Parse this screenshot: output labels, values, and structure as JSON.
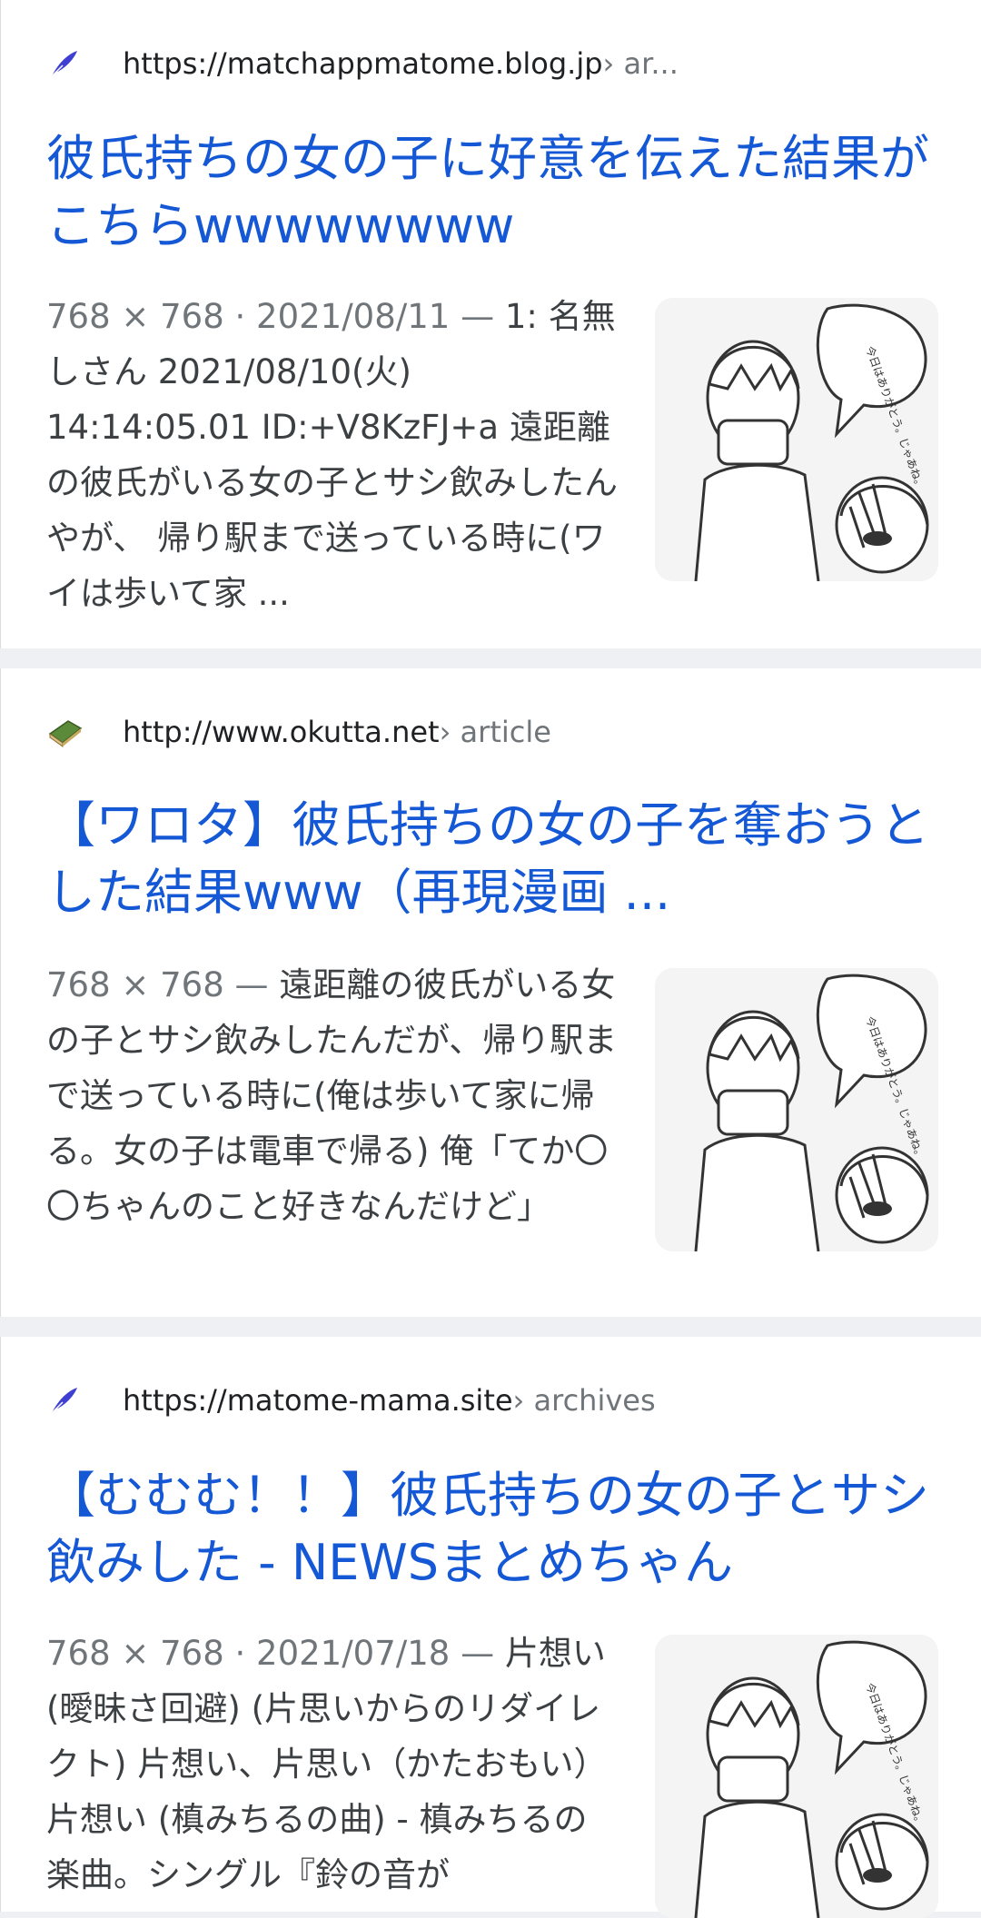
{
  "results": [
    {
      "favicon": "feather-icon",
      "url": "https://matchappmatome.blog.jp",
      "breadcrumb": " › ar...",
      "title": "彼氏持ちの女の子に好意を伝えた結果がこちらwwwwwwww",
      "meta": "768 × 768 · 2021/08/11 — ",
      "snippet": "1: 名無しさん 2021/08/10(火) 14:14:05.01 ID:+V8KzFJ+a 遠距離の彼氏がいる女の子とサシ飲みしたんやが、 帰り駅まで送っている時に(ワイは歩いて家 ...",
      "thumbnail": "manga-thumbnail"
    },
    {
      "favicon": "book-icon",
      "url": "http://www.okutta.net",
      "breadcrumb": " › article",
      "title": "【ワロタ】彼氏持ちの女の子を奪おうとした結果www（再現漫画 ...",
      "meta": "768 × 768 — ",
      "snippet": "遠距離の彼氏がいる女の子とサシ飲みしたんだが、帰り駅まで送っている時に(俺は歩いて家に帰る。女の子は電車で帰る) 俺「てか〇〇ちゃんのこと好きなんだけど」",
      "thumbnail": "manga-thumbnail"
    },
    {
      "favicon": "feather-icon",
      "url": "https://matome-mama.site",
      "breadcrumb": " › archives",
      "title": "【むむむ！！】彼氏持ちの女の子とサシ飲みした - NEWSまとめちゃん",
      "meta": "768 × 768 · 2021/07/18 — ",
      "snippet": "片想い (曖昧さ回避) (片思いからのリダイレクト) 片想い、片思い（かたおもい） 片想い (槙みちるの曲) - 槙みちるの楽曲。シングル『鈴の音が",
      "thumbnail": "manga-thumbnail"
    }
  ],
  "thumbnail_speech": "今日はありがとう。じゃあね。",
  "colors": {
    "title_link": "#1558d6",
    "url": "#202124",
    "breadcrumb": "#70757a",
    "snippet": "#3c4043",
    "separator": "#eef0f3"
  }
}
